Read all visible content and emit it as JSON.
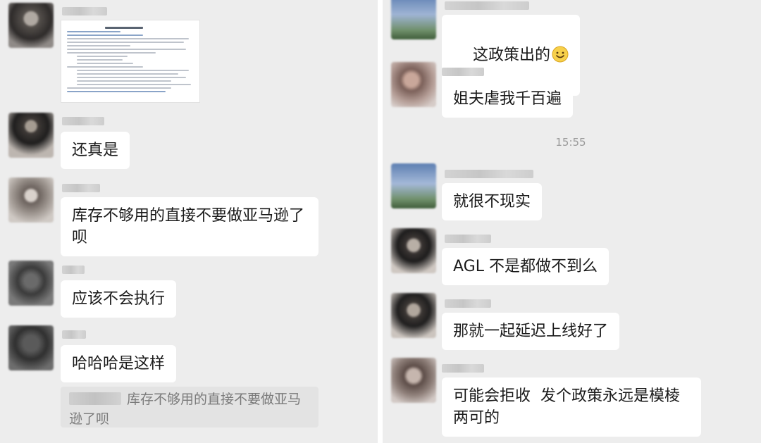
{
  "colors": {
    "chat_background": "#ededed",
    "bubble": "#ffffff",
    "text": "#1a1a1a",
    "timestamp": "#9a9a9a",
    "quote_background": "#e3e3e3"
  },
  "left_chat": {
    "messages": [
      {
        "type": "document-image",
        "content": "screenshot of a policy notice document (unreadable)"
      },
      {
        "text": "还真是"
      },
      {
        "text": "库存不够用的直接不要做亚马逊了\n呗"
      },
      {
        "text": "应该不会执行"
      },
      {
        "text": "哈哈哈是这样"
      }
    ],
    "quote": {
      "text": "库存不够用的直接不要做亚马逊了呗"
    }
  },
  "right_chat": {
    "messages_before_time": [
      {
        "text": "这政策出的",
        "emoji": "smile"
      },
      {
        "text": "姐夫虐我千百遍"
      }
    ],
    "timestamp": "15:55",
    "messages_after_time": [
      {
        "text": "就很不现实"
      },
      {
        "text": "AGL 不是都做不到么"
      },
      {
        "text": "那就一起延迟上线好了"
      },
      {
        "text": "可能会拒收  发个政策永远是模棱\n两可的"
      }
    ]
  }
}
